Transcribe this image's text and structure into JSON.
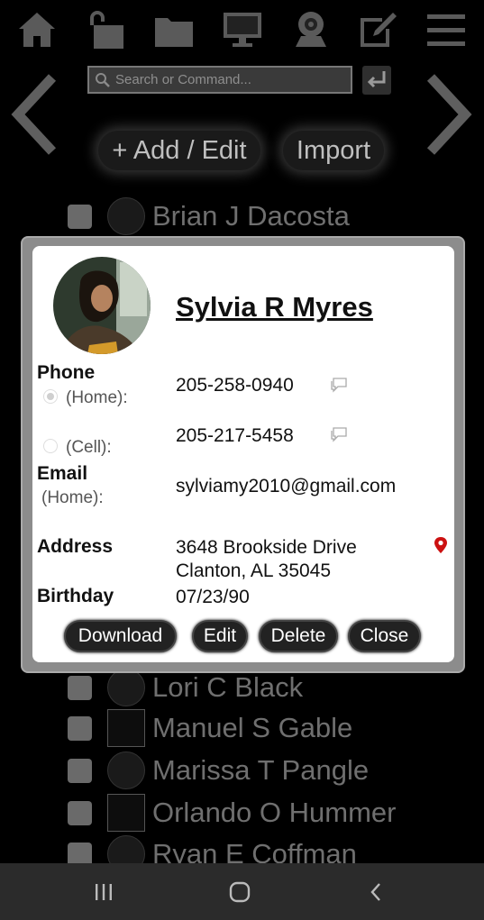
{
  "toolbar": {
    "icons": [
      "home-icon",
      "unlock-icon",
      "folder-icon",
      "monitor-icon",
      "webcam-icon",
      "edit-icon",
      "menu-icon"
    ]
  },
  "search": {
    "placeholder": "Search or Command..."
  },
  "buttons": {
    "add_edit": "+ Add / Edit",
    "import": "Import"
  },
  "contacts": [
    {
      "name": "Brian J Dacosta",
      "avatar": "photo"
    },
    {
      "name": "Lori C Black",
      "avatar": "photo"
    },
    {
      "name": "Manuel S Gable",
      "avatar": "broken"
    },
    {
      "name": "Marissa T Pangle",
      "avatar": "photo"
    },
    {
      "name": "Orlando O Hummer",
      "avatar": "broken"
    },
    {
      "name": "Ryan E Coffman",
      "avatar": "photo"
    }
  ],
  "modal": {
    "name": "Sylvia R Myres",
    "phone_label": "Phone",
    "phone_home_label": "(Home):",
    "phone_home": "205-258-0940",
    "phone_cell_label": "(Cell):",
    "phone_cell": "205-217-5458",
    "email_label": "Email",
    "email_home_label": "(Home):",
    "email_home": "sylviamy2010@gmail.com",
    "address_label": "Address",
    "address_line1": "3648 Brookside Drive",
    "address_line2": "Clanton, AL 35045",
    "birthday_label": "Birthday",
    "birthday": "07/23/90",
    "download_label": "Download",
    "edit_label": "Edit",
    "delete_label": "Delete",
    "close_label": "Close"
  },
  "colors": {
    "background": "#000000",
    "icon_gray": "#5a5a5a",
    "map_pin": "#cc1111",
    "nav_bar": "#2b2b2b"
  }
}
